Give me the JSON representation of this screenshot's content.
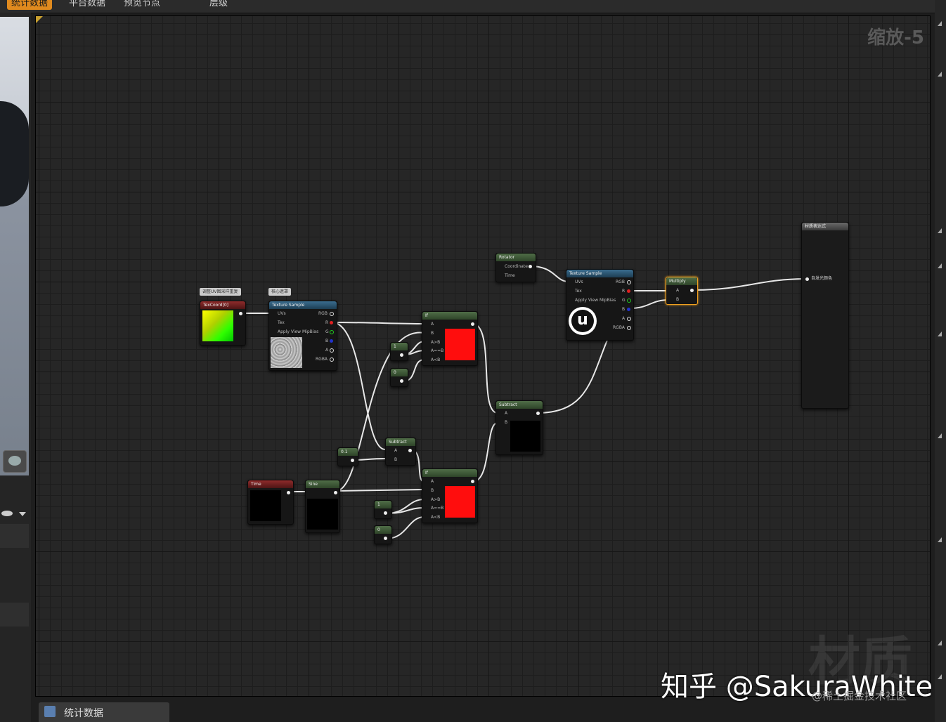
{
  "tabs": [
    "统计数据",
    "平台数据",
    "预览节点",
    "层级"
  ],
  "zoom_label": "缩放-5",
  "bottom_tab": "统计数据",
  "watermark": {
    "material": "材质",
    "zhihu": "知乎 @SakuraWhite",
    "juejin": "@稀土掘金技术社区"
  },
  "comments": {
    "c1": "调整UV图采样重复",
    "c2": "核心遮罩"
  },
  "nodes": {
    "texcoord": {
      "title": "TexCoord[0]"
    },
    "tex1": {
      "title": "Texture Sample",
      "in1": "UVs",
      "in2": "Tex",
      "in3": "Apply View MipBias",
      "rgb": "RGB",
      "r": "R",
      "g": "G",
      "b": "B",
      "a": "A",
      "rgba": "RGBA"
    },
    "rotator": {
      "title": "Rotator",
      "in1": "Coordinate",
      "in2": "Time"
    },
    "tex2": {
      "title": "Texture Sample",
      "in1": "UVs",
      "in2": "Tex",
      "in3": "Apply View MipBias",
      "rgb": "RGB",
      "r": "R",
      "g": "G",
      "b": "B",
      "a": "A",
      "rgba": "RGBA"
    },
    "multiply": {
      "title": "Multiply",
      "a": "A",
      "b": "B"
    },
    "if1": {
      "title": "If",
      "a": "A",
      "b": "B",
      "agb": "A>B",
      "aeb": "A==B",
      "alb": "A<B"
    },
    "if2": {
      "title": "If",
      "a": "A",
      "b": "B",
      "agb": "A>B",
      "aeb": "A==B",
      "alb": "A<B"
    },
    "const1": {
      "value": "1"
    },
    "const0": {
      "value": "0"
    },
    "const01": {
      "value": "0.1"
    },
    "const1b": {
      "value": "1"
    },
    "const0b": {
      "value": "0"
    },
    "subtract1": {
      "title": "Subtract",
      "a": "A",
      "b": "B"
    },
    "subtract2": {
      "title": "Subtract",
      "a": "A",
      "b": "B"
    },
    "time": {
      "title": "Time"
    },
    "sine": {
      "title": "Sine"
    },
    "result": {
      "title": "材质表达式",
      "emissive": "自发光颜色"
    }
  }
}
